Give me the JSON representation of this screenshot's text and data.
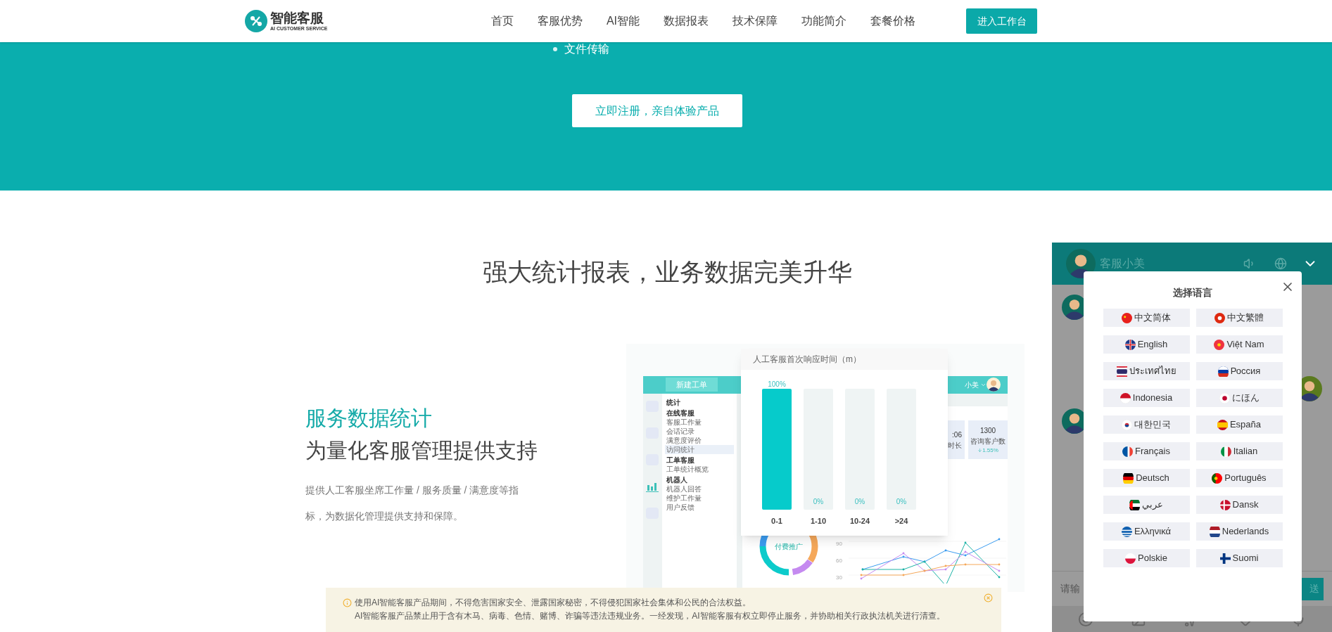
{
  "header": {
    "logo": {
      "name": "智能客服",
      "tagline": "AI CUSTOMER SERVICE"
    },
    "nav": [
      "首页",
      "客服优势",
      "AI智能",
      "数据报表",
      "技术保障",
      "功能简介",
      "套餐价格"
    ],
    "cta": "进入工作台"
  },
  "banner": {
    "bullet": "文件传输",
    "button": "立即注册，亲自体验产品"
  },
  "section": {
    "title": "强大统计报表，业务数据完美升华",
    "heading": "服务数据统计",
    "subheading": "为量化客服管理提供支持",
    "paragraph": "提供人工客服坐席工作量 / 服务质量 / 满意度等指标，为数据化管理提供支持和保障。"
  },
  "mockup": {
    "new_ticket": "新建工单",
    "user": "小美",
    "menu": [
      {
        "kind": "group",
        "label": "统计",
        "selected": false
      },
      {
        "kind": "group",
        "label": "在线客服",
        "selected": false
      },
      {
        "kind": "item",
        "label": "客服工作量",
        "selected": false
      },
      {
        "kind": "item",
        "label": "会话记录",
        "selected": false
      },
      {
        "kind": "item",
        "label": "满意度评价",
        "selected": false
      },
      {
        "kind": "item",
        "label": "访问统计",
        "selected": true
      },
      {
        "kind": "group",
        "label": "工单客服",
        "selected": false
      },
      {
        "kind": "item",
        "label": "工单统计概览",
        "selected": false
      },
      {
        "kind": "group",
        "label": "机器人",
        "selected": false
      },
      {
        "kind": "item",
        "label": "机器人回答",
        "selected": false
      },
      {
        "kind": "item",
        "label": "维护工作量",
        "selected": false
      },
      {
        "kind": "item",
        "label": "用户反馈",
        "selected": false
      }
    ],
    "stats": [
      {
        "value": ":06",
        "label": "时长"
      },
      {
        "value": "1300",
        "label": "咨询客户数",
        "change": "1.55%"
      }
    ],
    "donut_label": "付费推广",
    "response_chart": {
      "chart_data": {
        "type": "bar",
        "title": "人工客服首次响应时间（m）",
        "categories": [
          "0-1",
          "1-10",
          "10-24",
          ">24"
        ],
        "values": [
          100,
          0,
          0,
          0
        ],
        "ylim": [
          0,
          100
        ],
        "value_labels": [
          "100%",
          "0%",
          "0%",
          "0%"
        ]
      }
    },
    "line_chart": {
      "axis_labels": [
        "90",
        "60",
        "30"
      ]
    }
  },
  "chat": {
    "agent": "客服小美",
    "input_placeholder": "请输",
    "send": "送",
    "language_dialog": {
      "title": "选择语言",
      "languages": [
        "中文简体",
        "中文繁體",
        "English",
        "Việt Nam",
        "ประเทศไทย",
        "Россия",
        "Indonesia",
        "にほん",
        "대한민국",
        "España",
        "Français",
        "Italian",
        "Deutsch",
        "Português",
        "عربي",
        "Dansk",
        "Ελληνικά",
        "Nederlands",
        "Polskie",
        "Suomi"
      ]
    }
  },
  "notice": [
    "使用AI智能客服产品期间，不得危害国家安全、泄露国家秘密，不得侵犯国家社会集体和公民的合法权益。",
    "AI智能客服产品禁止用于含有木马、病毒、色情、赌博、诈骗等违法违规业务。一经发现，AI智能客服有权立即停止服务，并协助相关行政执法机关进行清查。"
  ]
}
